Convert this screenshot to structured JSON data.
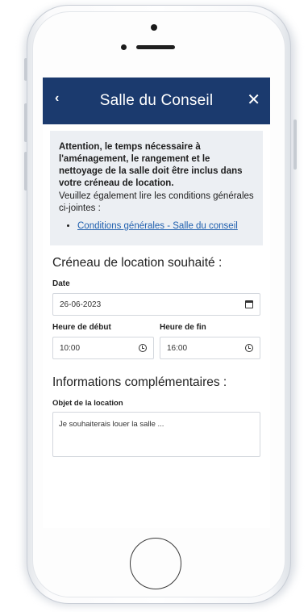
{
  "header": {
    "back_icon": "‹",
    "title": "Salle du Conseil",
    "close_icon": "✕",
    "background_color": "#1b3a6e"
  },
  "notice": {
    "bold_text": "Attention, le temps nécessaire à l'aménagement, le rangement et le nettoyage de la salle doit être inclus dans votre créneau de location.",
    "text": "Veuillez également lire les conditions générales ci-jointes :",
    "link": "Conditions générales - Salle du conseil",
    "link_color": "#1f5fae"
  },
  "booking": {
    "section_title": "Créneau de location souhaité :",
    "date_label": "Date",
    "date_value": "26-06-2023",
    "start_label": "Heure de début",
    "start_value": "10:00",
    "end_label": "Heure de fin",
    "end_value": "16:00"
  },
  "extra": {
    "section_title": "Informations complémentaires :",
    "purpose_label": "Objet de la location",
    "purpose_value": "Je souhaiterais louer la salle ..."
  },
  "icons": {
    "calendar": "calendar-icon",
    "clock": "clock-icon"
  }
}
